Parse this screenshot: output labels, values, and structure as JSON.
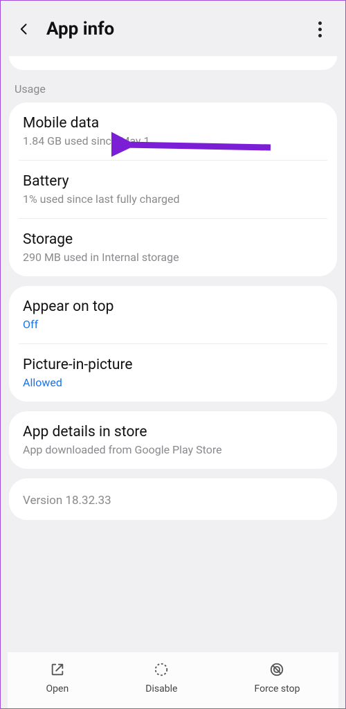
{
  "header": {
    "title": "App info"
  },
  "section_label": "Usage",
  "usage": {
    "mobile_data": {
      "title": "Mobile data",
      "sub": "1.84 GB used since May 1"
    },
    "battery": {
      "title": "Battery",
      "sub": "1% used since last fully charged"
    },
    "storage": {
      "title": "Storage",
      "sub": "290 MB used in Internal storage"
    }
  },
  "overlay": {
    "appear_on_top": {
      "title": "Appear on top",
      "status": "Off"
    },
    "pip": {
      "title": "Picture-in-picture",
      "status": "Allowed"
    }
  },
  "store": {
    "title": "App details in store",
    "sub": "App downloaded from Google Play Store"
  },
  "version": "Version 18.32.33",
  "bottom": {
    "open": "Open",
    "disable": "Disable",
    "force_stop": "Force stop"
  }
}
